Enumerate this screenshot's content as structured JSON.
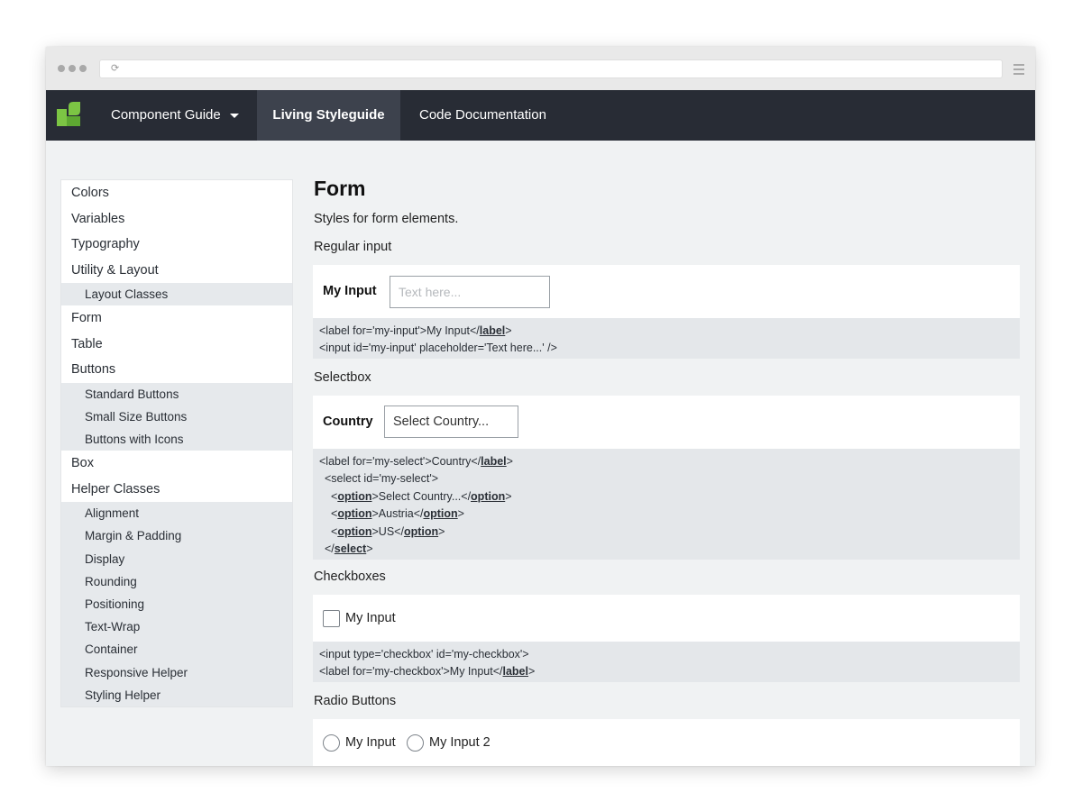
{
  "browser": {
    "reload_icon": "reload-icon",
    "menu_icon": "hamburger-icon"
  },
  "nav": {
    "logo_icon": "leaf-logo-icon",
    "brand_color": "#7cc544",
    "items": [
      {
        "label": "Component Guide",
        "dropdown": true
      },
      {
        "label": "Living Styleguide",
        "active": true
      },
      {
        "label": "Code Documentation"
      }
    ]
  },
  "sidebar": {
    "colors": "Colors",
    "variables": "Variables",
    "typography": "Typography",
    "utility_layout": "Utility & Layout",
    "layout_classes": "Layout Classes",
    "form": "Form",
    "table": "Table",
    "buttons": "Buttons",
    "standard_buttons": "Standard Buttons",
    "small_size_buttons": "Small Size Buttons",
    "buttons_with_icons": "Buttons with Icons",
    "box": "Box",
    "helper_classes": "Helper Classes",
    "helpers": [
      "Alignment",
      "Margin & Padding",
      "Display",
      "Rounding",
      "Positioning",
      "Text-Wrap",
      "Container",
      "Responsive Helper",
      "Styling Helper"
    ]
  },
  "main": {
    "title": "Form",
    "description": "Styles for form elements.",
    "regular_input": {
      "heading": "Regular input",
      "label": "My Input",
      "placeholder": "Text here...",
      "code": {
        "l1_a": "<label for='my-input'>My Input</",
        "l1_kw": "label",
        "l1_b": ">",
        "l2": "<input id='my-input' placeholder='Text here...' />"
      }
    },
    "selectbox": {
      "heading": "Selectbox",
      "label": "Country",
      "selected": "Select Country...",
      "code": {
        "l1_a": "<label for='my-select'>Country</",
        "l1_kw": "label",
        "l1_b": ">",
        "l2": "<select id='my-select'>",
        "opt": "option",
        "l3_mid": ">Select Country...</",
        "l4_mid": ">Austria</",
        "l5_mid": ">US</",
        "lt": "<",
        "gt": ">",
        "close_a": "</",
        "close_kw": "select",
        "close_b": ">"
      }
    },
    "checkboxes": {
      "heading": "Checkboxes",
      "label": "My Input",
      "code": {
        "l1": "<input type='checkbox' id='my-checkbox'>",
        "l2_a": "<label for='my-checkbox'>My Input</",
        "l2_kw": "label",
        "l2_b": ">"
      }
    },
    "radio_buttons": {
      "heading": "Radio Buttons",
      "label1": "My Input",
      "label2": "My Input 2"
    }
  }
}
